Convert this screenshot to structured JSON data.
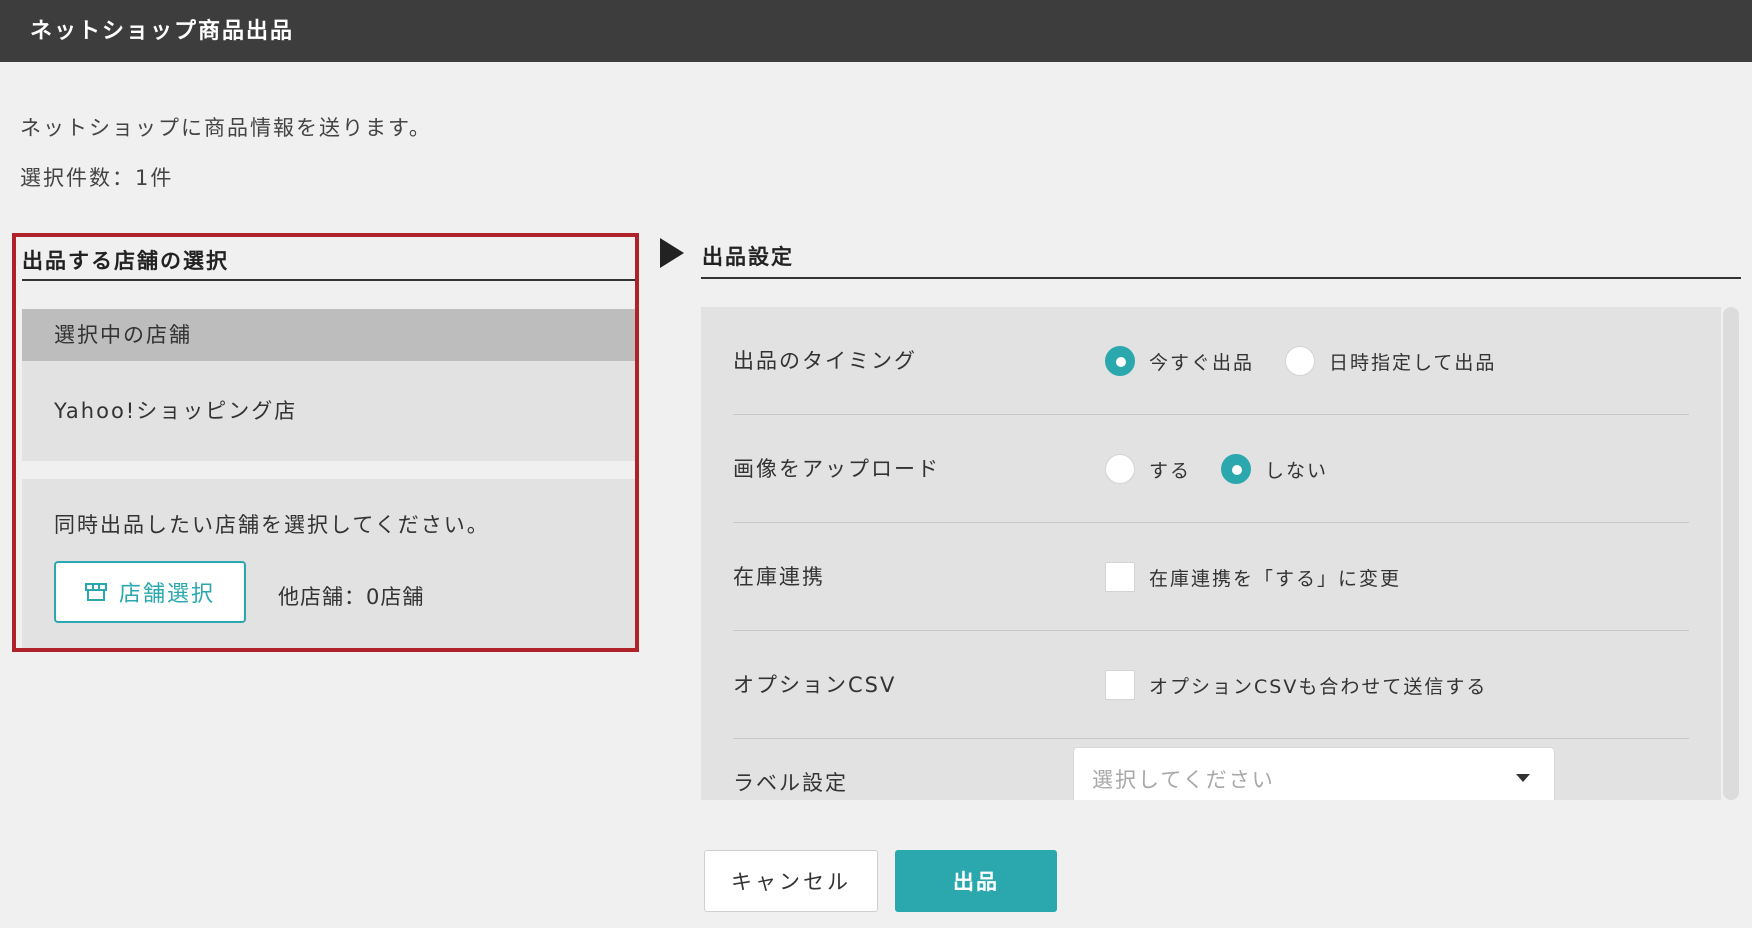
{
  "window": {
    "title": "ネットショップ商品出品"
  },
  "intro": {
    "description": "ネットショップに商品情報を送ります。",
    "selected_count": "選択件数：1件"
  },
  "store_section": {
    "title": "出品する店舗の選択",
    "current_header": "選択中の店舗",
    "current_store": "Yahoo!ショッピング店",
    "multi_prompt": "同時出品したい店舗を選択してください。",
    "select_button_label": "店舗選択",
    "select_button_icon": "store-icon",
    "other_count": "他店舗：0店舗"
  },
  "settings_section": {
    "title": "出品設定",
    "timing": {
      "label": "出品のタイミング",
      "options": [
        {
          "label": "今すぐ出品",
          "selected": true
        },
        {
          "label": "日時指定して出品",
          "selected": false
        }
      ]
    },
    "image_upload": {
      "label": "画像をアップロード",
      "options": [
        {
          "label": "する",
          "selected": false
        },
        {
          "label": "しない",
          "selected": true
        }
      ]
    },
    "stock_sync": {
      "label": "在庫連携",
      "checkbox_label": "在庫連携を「する」に変更",
      "checked": false
    },
    "option_csv": {
      "label": "オプションCSV",
      "checkbox_label": "オプションCSVも合わせて送信する",
      "checked": false
    },
    "label_setting": {
      "label": "ラベル設定",
      "placeholder": "選択してください"
    }
  },
  "footer": {
    "cancel_label": "キャンセル",
    "submit_label": "出品"
  },
  "colors": {
    "accent": "#2aa8ad",
    "title_bar": "#3d3d3d",
    "highlight_border": "#b0222a",
    "background": "#f0f0f0"
  }
}
